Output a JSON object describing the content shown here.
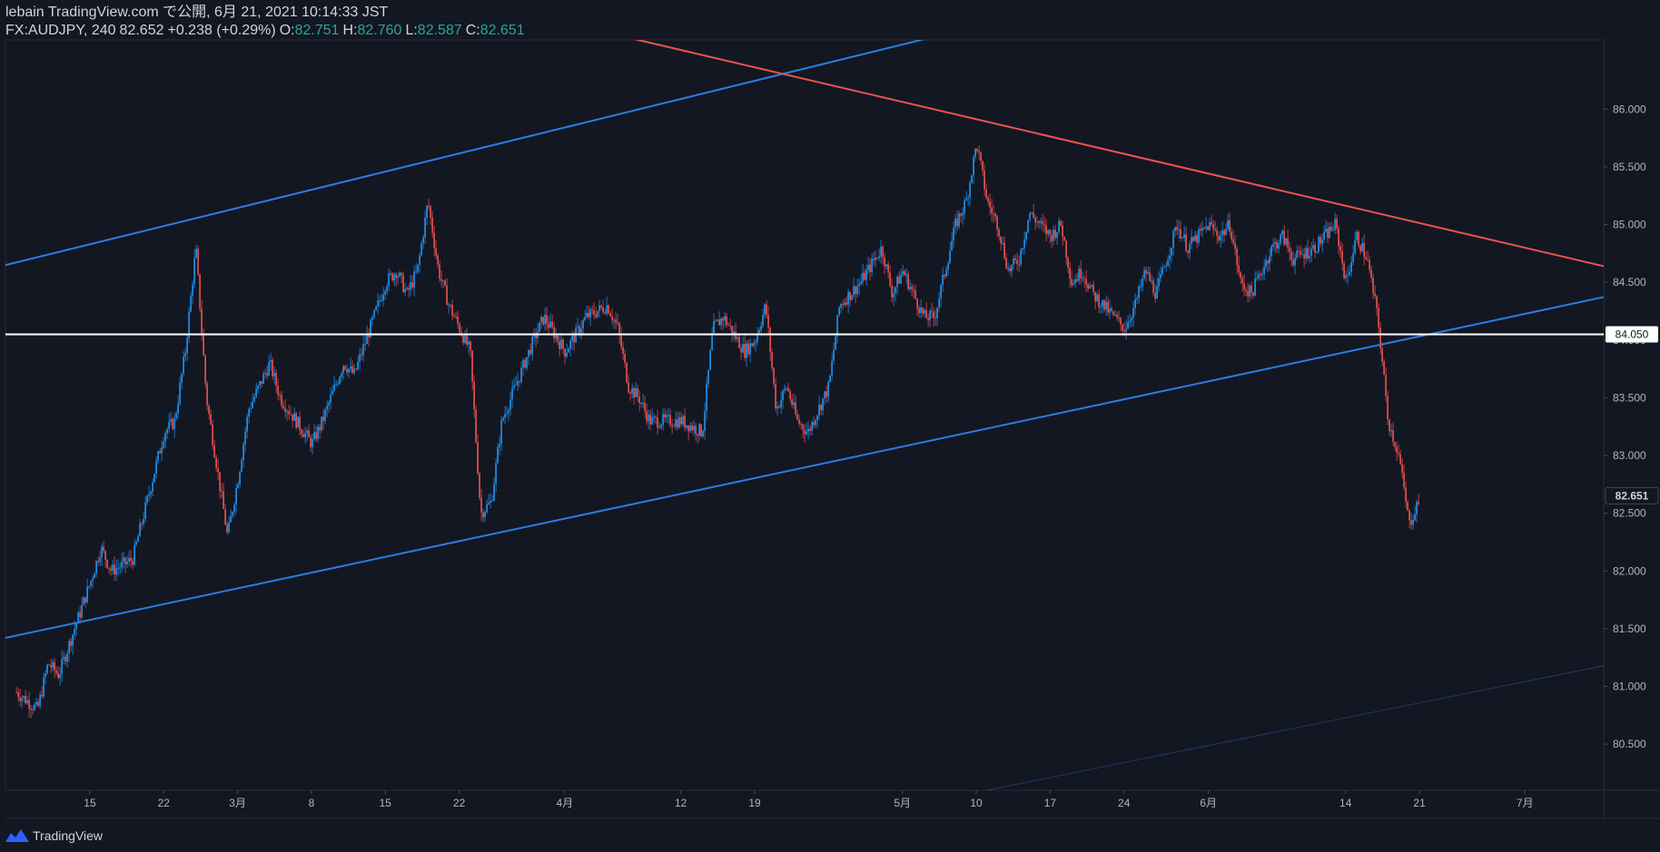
{
  "header": {
    "line1": "lebain TradingView.com で公開, 6月 21, 2021 10:14:33 JST",
    "symbol": "FX:AUDJPY, 240",
    "last": "82.652",
    "change": "+0.238 (+0.29%)",
    "o_label": "O:",
    "o_value": "82.751",
    "h_label": "H:",
    "h_value": "82.760",
    "l_label": "L:",
    "l_value": "82.587",
    "c_label": "C:",
    "c_value": "82.651"
  },
  "footer": {
    "brand": "TradingView"
  },
  "colors": {
    "background": "#131722",
    "up": "#2196f3",
    "down": "#ef5350",
    "trend_blue": "#2a7de1",
    "trend_red": "#ef5350",
    "level": "#ffffff",
    "grid": "#1c2030"
  },
  "chart_data": {
    "type": "candlestick",
    "symbol": "FX:AUDJPY",
    "interval": "240",
    "ylim": [
      80.1,
      86.6
    ],
    "y_ticks": [
      "86.000",
      "85.500",
      "85.000",
      "84.500",
      "84.000",
      "83.500",
      "83.000",
      "82.500",
      "82.000",
      "81.500",
      "81.000",
      "80.500"
    ],
    "x_ticks": [
      {
        "label": "15",
        "date": "2021-02-15"
      },
      {
        "label": "22",
        "date": "2021-02-22"
      },
      {
        "label": "3月",
        "date": "2021-03-01"
      },
      {
        "label": "8",
        "date": "2021-03-08"
      },
      {
        "label": "15",
        "date": "2021-03-15"
      },
      {
        "label": "22",
        "date": "2021-03-22"
      },
      {
        "label": "4月",
        "date": "2021-04-01"
      },
      {
        "label": "12",
        "date": "2021-04-12"
      },
      {
        "label": "19",
        "date": "2021-04-19"
      },
      {
        "label": "5月",
        "date": "2021-05-03"
      },
      {
        "label": "10",
        "date": "2021-05-10"
      },
      {
        "label": "17",
        "date": "2021-05-17"
      },
      {
        "label": "24",
        "date": "2021-05-24"
      },
      {
        "label": "6月",
        "date": "2021-06-01"
      },
      {
        "label": "14",
        "date": "2021-06-14"
      },
      {
        "label": "21",
        "date": "2021-06-21"
      },
      {
        "label": "7月",
        "date": "2021-07-01"
      }
    ],
    "horizontal_level": {
      "value": 84.05,
      "label": "84.050"
    },
    "last_price": {
      "value": 82.651,
      "label": "82.651"
    },
    "path": [
      [
        "2021-02-08",
        80.95
      ],
      [
        "2021-02-10",
        80.8
      ],
      [
        "2021-02-11",
        81.2
      ],
      [
        "2021-02-12",
        81.1
      ],
      [
        "2021-02-15",
        81.9
      ],
      [
        "2021-02-16",
        82.2
      ],
      [
        "2021-02-17",
        82.0
      ],
      [
        "2021-02-19",
        82.1
      ],
      [
        "2021-02-22",
        83.2
      ],
      [
        "2021-02-23",
        83.3
      ],
      [
        "2021-02-24",
        83.9
      ],
      [
        "2021-02-25",
        84.8
      ],
      [
        "2021-02-26",
        83.5
      ],
      [
        "2021-02-28",
        82.3
      ],
      [
        "2021-03-01",
        82.8
      ],
      [
        "2021-03-02",
        83.4
      ],
      [
        "2021-03-04",
        83.8
      ],
      [
        "2021-03-05",
        83.5
      ],
      [
        "2021-03-08",
        83.1
      ],
      [
        "2021-03-09",
        83.3
      ],
      [
        "2021-03-11",
        83.8
      ],
      [
        "2021-03-12",
        83.7
      ],
      [
        "2021-03-15",
        84.5
      ],
      [
        "2021-03-16",
        84.6
      ],
      [
        "2021-03-17",
        84.4
      ],
      [
        "2021-03-18",
        84.6
      ],
      [
        "2021-03-19",
        85.2
      ],
      [
        "2021-03-20",
        84.6
      ],
      [
        "2021-03-21",
        84.3
      ],
      [
        "2021-03-22",
        84.1
      ],
      [
        "2021-03-23",
        83.9
      ],
      [
        "2021-03-24",
        82.5
      ],
      [
        "2021-03-25",
        82.6
      ],
      [
        "2021-03-26",
        83.3
      ],
      [
        "2021-03-29",
        84.0
      ],
      [
        "2021-03-30",
        84.2
      ],
      [
        "2021-04-01",
        83.9
      ],
      [
        "2021-04-03",
        84.2
      ],
      [
        "2021-04-05",
        84.3
      ],
      [
        "2021-04-06",
        84.1
      ],
      [
        "2021-04-07",
        83.6
      ],
      [
        "2021-04-08",
        83.5
      ],
      [
        "2021-04-09",
        83.3
      ],
      [
        "2021-04-12",
        83.3
      ],
      [
        "2021-04-14",
        83.2
      ],
      [
        "2021-04-15",
        84.1
      ],
      [
        "2021-04-16",
        84.2
      ],
      [
        "2021-04-18",
        83.9
      ],
      [
        "2021-04-19",
        84.0
      ],
      [
        "2021-04-20",
        84.3
      ],
      [
        "2021-04-21",
        83.4
      ],
      [
        "2021-04-22",
        83.6
      ],
      [
        "2021-04-23",
        83.3
      ],
      [
        "2021-04-24",
        83.2
      ],
      [
        "2021-04-26",
        83.6
      ],
      [
        "2021-04-27",
        84.3
      ],
      [
        "2021-04-29",
        84.5
      ],
      [
        "2021-05-01",
        84.8
      ],
      [
        "2021-05-02",
        84.4
      ],
      [
        "2021-05-03",
        84.6
      ],
      [
        "2021-05-05",
        84.2
      ],
      [
        "2021-05-06",
        84.2
      ],
      [
        "2021-05-07",
        84.6
      ],
      [
        "2021-05-08",
        85.0
      ],
      [
        "2021-05-09",
        85.2
      ],
      [
        "2021-05-10",
        85.7
      ],
      [
        "2021-05-11",
        85.2
      ],
      [
        "2021-05-12",
        85.0
      ],
      [
        "2021-05-13",
        84.6
      ],
      [
        "2021-05-14",
        84.7
      ],
      [
        "2021-05-15",
        85.1
      ],
      [
        "2021-05-17",
        84.9
      ],
      [
        "2021-05-18",
        85.0
      ],
      [
        "2021-05-19",
        84.5
      ],
      [
        "2021-05-20",
        84.6
      ],
      [
        "2021-05-21",
        84.4
      ],
      [
        "2021-05-22",
        84.3
      ],
      [
        "2021-05-24",
        84.1
      ],
      [
        "2021-05-25",
        84.3
      ],
      [
        "2021-05-26",
        84.6
      ],
      [
        "2021-05-27",
        84.4
      ],
      [
        "2021-05-29",
        85.0
      ],
      [
        "2021-05-30",
        84.8
      ],
      [
        "2021-06-01",
        85.0
      ],
      [
        "2021-06-02",
        84.9
      ],
      [
        "2021-06-03",
        85.0
      ],
      [
        "2021-06-04",
        84.5
      ],
      [
        "2021-06-05",
        84.4
      ],
      [
        "2021-06-07",
        84.8
      ],
      [
        "2021-06-08",
        84.9
      ],
      [
        "2021-06-09",
        84.7
      ],
      [
        "2021-06-11",
        84.8
      ],
      [
        "2021-06-13",
        85.0
      ],
      [
        "2021-06-14",
        84.5
      ],
      [
        "2021-06-15",
        84.9
      ],
      [
        "2021-06-16",
        84.7
      ],
      [
        "2021-06-17",
        84.2
      ],
      [
        "2021-06-18",
        83.3
      ],
      [
        "2021-06-19",
        83.0
      ],
      [
        "2021-06-20",
        82.4
      ],
      [
        "2021-06-21",
        82.65
      ]
    ],
    "trend_lines": [
      {
        "color": "blue",
        "from": [
          "2021-02-07",
          84.65
        ],
        "to": [
          "2021-05-07",
          86.65
        ]
      },
      {
        "color": "red",
        "from": [
          "2021-04-07",
          86.62
        ],
        "to": [
          "2021-07-15",
          84.5
        ]
      },
      {
        "color": "blue",
        "from": [
          "2021-02-07",
          81.42
        ],
        "to": [
          "2021-07-15",
          84.5
        ]
      },
      {
        "color": "blue-faint",
        "from": [
          "2021-05-11",
          80.1
        ],
        "to": [
          "2021-07-15",
          81.3
        ]
      }
    ]
  }
}
